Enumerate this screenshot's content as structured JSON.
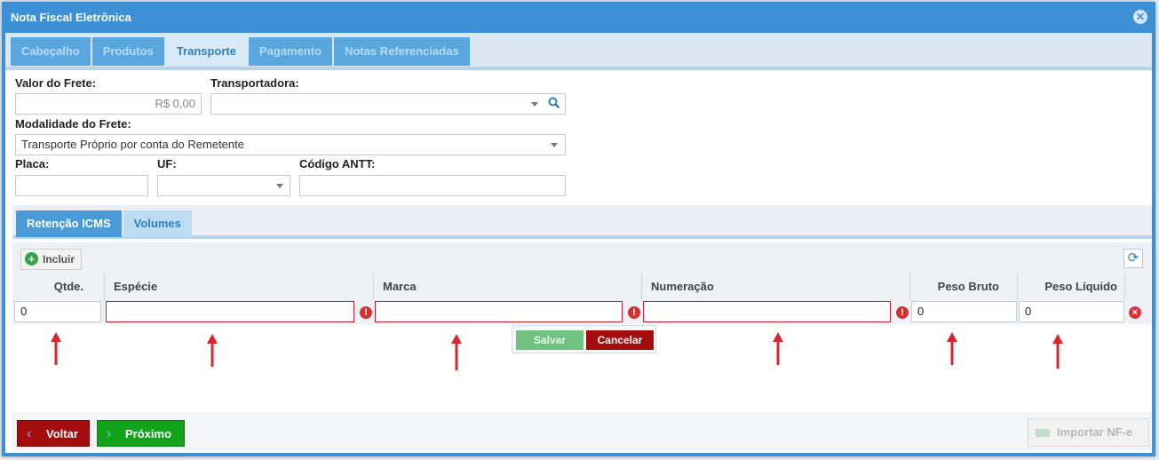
{
  "window": {
    "title": "Nota Fiscal Eletrônica"
  },
  "tabs": [
    "Cabeçalho",
    "Produtos",
    "Transporte",
    "Pagamento",
    "Notas Referenciadas"
  ],
  "form": {
    "valor_frete_label": "Valor do Frete:",
    "valor_frete_value": "R$ 0,00",
    "transportadora_label": "Transportadora:",
    "transportadora_value": "",
    "modalidade_label": "Modalidade do Frete:",
    "modalidade_value": "Transporte Próprio por conta do Remetente",
    "placa_label": "Placa:",
    "placa_value": "",
    "uf_label": "UF:",
    "uf_value": "",
    "antt_label": "Código ANTT:",
    "antt_value": ""
  },
  "subtabs": [
    "Retenção ICMS",
    "Volumes"
  ],
  "grid": {
    "incluir_label": "Incluir",
    "columns": [
      "Qtde.",
      "Espécie",
      "Marca",
      "Numeração",
      "Peso Bruto",
      "Peso Líquido"
    ],
    "row": [
      "0",
      "",
      "",
      "",
      "0",
      "0"
    ]
  },
  "edit": {
    "save_label": "Salvar",
    "cancel_label": "Cancelar"
  },
  "footer": {
    "back_label": "Voltar",
    "next_label": "Próximo",
    "import_label": "Importar NF-e"
  },
  "colors": {
    "accent": "#3d90d3",
    "danger": "#a30d0d",
    "success": "#12a31a",
    "annotation_arrow": "#d9262c"
  }
}
